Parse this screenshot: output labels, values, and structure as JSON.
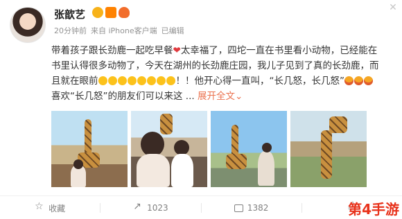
{
  "post": {
    "username": "张歆艺",
    "time": "20分钟前",
    "source": "来自 iPhone客户端",
    "edited": "已编辑",
    "text": {
      "line1_a": "带着孩子跟长劲鹿一起吃早餐",
      "heart": "❤",
      "line1_b": "太幸福了，四坨一直在书里看小动物，已经能在",
      "line2": "书里认得很多动物了，今天在湖州的长劲鹿庄园，我儿子见到了真的长劲鹿，而",
      "line3_a": "且就在眼前",
      "line3_b": "！！他开心得一直叫，“长几怒，长几怒”",
      "line4": "喜欢“长几怒”的朋友们可以来这 ...",
      "expand": "展开全文",
      "expand_chevron": "⌄"
    }
  },
  "actions": {
    "favorite_label": "收藏",
    "share_count": "1023",
    "comment_count": "1382"
  },
  "watermark": "第4手游",
  "close_glyph": "✕"
}
